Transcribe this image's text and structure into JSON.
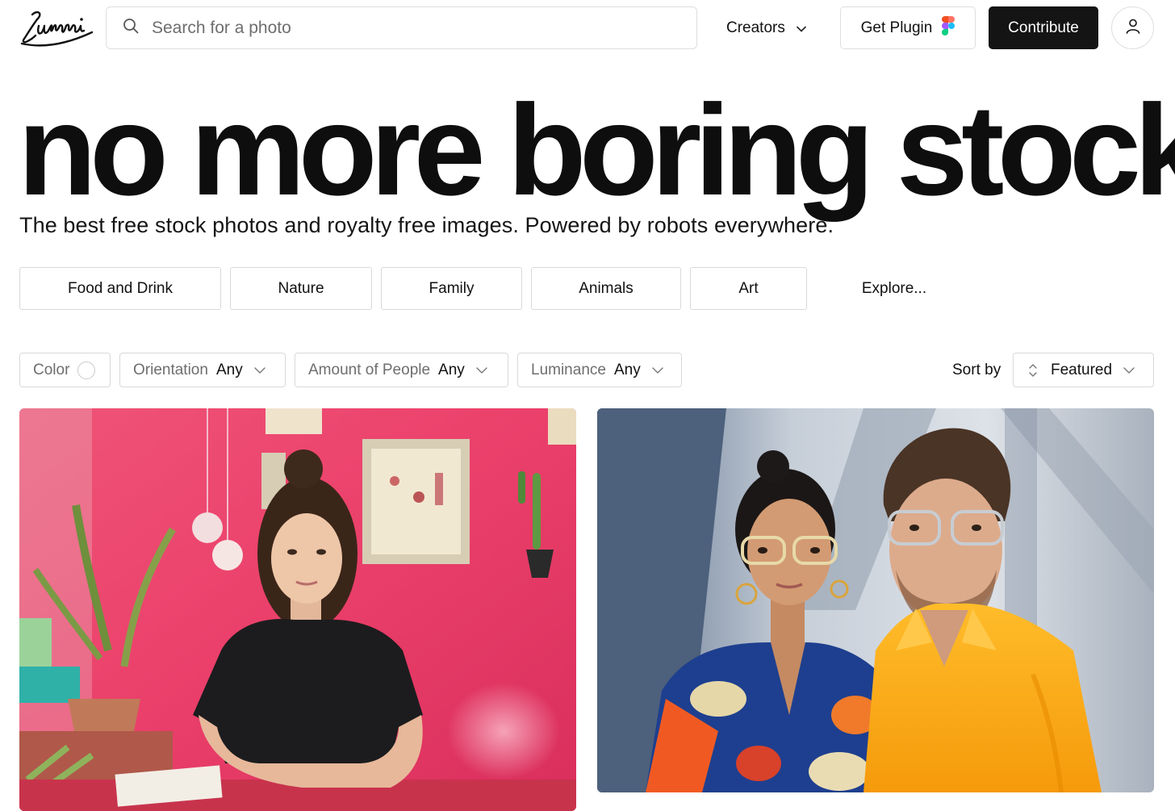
{
  "brand": {
    "logo_text": "Lummi"
  },
  "search": {
    "placeholder": "Search for a photo",
    "icon": "search-icon"
  },
  "nav": {
    "creators_label": "Creators",
    "plugin_label": "Get Plugin",
    "contribute_label": "Contribute",
    "user_icon": "user-icon"
  },
  "hero": {
    "title": "no more boring stock",
    "subtitle": "The best free stock photos and royalty free images. Powered by robots everywhere."
  },
  "categories": [
    "Food and Drink",
    "Nature",
    "Family",
    "Animals",
    "Art",
    "Explore..."
  ],
  "filters": {
    "color_label": "Color",
    "orientation": {
      "label": "Orientation",
      "value": "Any"
    },
    "people": {
      "label": "Amount of People",
      "value": "Any"
    },
    "luminance": {
      "label": "Luminance",
      "value": "Any"
    }
  },
  "sort": {
    "label": "Sort by",
    "value": "Featured"
  },
  "colors": {
    "contribute_bg": "#141414",
    "border": "#d9d9d9",
    "photo1_wall": "#ea3f6a",
    "photo2_shirt": "#fbb010"
  }
}
